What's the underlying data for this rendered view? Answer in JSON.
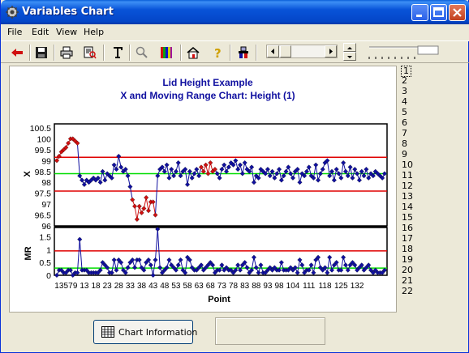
{
  "window": {
    "title": "Variables Chart"
  },
  "menu": [
    "File",
    "Edit",
    "View",
    "Help"
  ],
  "toolbar": {
    "buttons": [
      "back-arrow-icon",
      "save-icon",
      "print-icon",
      "print-preview-icon",
      "text-icon",
      "zoom-icon",
      "color-palette-icon",
      "home-icon",
      "help-icon",
      "chart-options-icon"
    ]
  },
  "list": {
    "items": [
      "1",
      "2",
      "3",
      "4",
      "5",
      "6",
      "7",
      "8",
      "9",
      "10",
      "11",
      "12",
      "13",
      "14",
      "15",
      "16",
      "17",
      "18",
      "19",
      "20",
      "21",
      "22"
    ],
    "selected": "1"
  },
  "buttons": {
    "chart_info": "Chart Information"
  },
  "chart_data": [
    {
      "type": "line",
      "title": "Lid Height Example",
      "subtitle": "X and Moving Range Chart: Height (1)",
      "ylabel": "X",
      "xlabel": "Point",
      "ylim": [
        96,
        100.5
      ],
      "yticks": [
        "100.5",
        "100",
        "99.5",
        "99",
        "98.5",
        "98",
        "97.5",
        "97",
        "96.5",
        "96"
      ],
      "control_limits": {
        "ucl": 99.15,
        "center": 98.4,
        "lcl": 97.6
      },
      "colors": {
        "ucl": "#e00000",
        "center": "#00dd00",
        "lcl": "#e00000",
        "points": "#1010a0",
        "out_of_control": "#d01010",
        "line": "#1010a0"
      },
      "values": [
        99.0,
        99.2,
        99.4,
        99.5,
        99.6,
        99.8,
        100.0,
        100.0,
        99.9,
        99.8,
        98.3,
        98.1,
        97.9,
        98.1,
        98.0,
        98.1,
        98.2,
        98.1,
        98.2,
        98.0,
        98.5,
        98.1,
        98.4,
        98.3,
        98.2,
        98.8,
        98.6,
        99.2,
        98.7,
        98.5,
        98.6,
        98.3,
        97.8,
        97.2,
        96.9,
        96.3,
        96.9,
        96.6,
        96.8,
        97.3,
        96.7,
        97.1,
        97.1,
        96.5,
        98.3,
        98.6,
        98.7,
        98.5,
        98.8,
        98.2,
        98.6,
        98.3,
        98.5,
        98.9,
        98.3,
        98.5,
        98.6,
        97.9,
        98.5,
        98.2,
        98.4,
        98.6,
        98.3,
        98.7,
        98.5,
        98.8,
        98.4,
        98.9,
        98.5,
        98.6,
        98.4,
        98.2,
        98.6,
        98.8,
        98.5,
        98.7,
        98.9,
        98.8,
        99.0,
        98.6,
        98.8,
        98.4,
        98.9,
        98.6,
        98.5,
        98.7,
        98.0,
        98.3,
        98.2,
        98.6,
        98.5,
        98.4,
        98.6,
        98.3,
        98.5,
        98.2,
        98.4,
        98.6,
        98.1,
        98.3,
        98.5,
        98.7,
        98.4,
        98.2,
        98.5,
        98.6,
        98.0,
        98.4,
        98.3,
        98.5,
        98.7,
        98.3,
        98.2,
        98.8,
        98.1,
        98.4,
        98.6,
        98.9,
        99.0,
        98.3,
        98.5,
        98.1,
        98.6,
        98.4,
        98.2,
        98.9,
        98.5,
        98.3,
        98.7,
        98.2,
        98.6,
        98.4,
        98.1,
        98.5,
        98.3,
        98.6,
        98.2,
        98.4,
        98.3,
        98.5,
        98.4,
        98.3,
        98.2,
        98.4
      ],
      "out_of_control_indices": [
        0,
        1,
        2,
        3,
        4,
        5,
        6,
        7,
        8,
        9,
        33,
        34,
        35,
        36,
        37,
        38,
        39,
        40,
        41,
        42,
        43,
        63,
        64,
        65,
        66,
        67,
        68,
        69
      ]
    },
    {
      "type": "line",
      "ylabel": "MR",
      "xlabel": "Point",
      "ylim": [
        0,
        1.8
      ],
      "yticks": [
        "1.5",
        "1",
        "0.5",
        "0"
      ],
      "control_limits": {
        "ucl": 0.95,
        "center": 0.28,
        "lcl": 0
      },
      "x_tick_labels": [
        "1",
        "3",
        "5",
        "7",
        "9",
        "13",
        "18",
        "23",
        "28",
        "33",
        "38",
        "43",
        "48",
        "53",
        "58",
        "63",
        "68",
        "73",
        "78",
        "83",
        "88",
        "93",
        "98",
        "104",
        "111",
        "118",
        "125",
        "132"
      ],
      "values": [
        0.0,
        0.2,
        0.2,
        0.1,
        0.1,
        0.2,
        0.2,
        0.0,
        0.1,
        0.1,
        1.4,
        0.2,
        0.2,
        0.2,
        0.1,
        0.1,
        0.1,
        0.1,
        0.1,
        0.2,
        0.5,
        0.4,
        0.3,
        0.1,
        0.1,
        0.6,
        0.2,
        0.6,
        0.5,
        0.2,
        0.1,
        0.3,
        0.5,
        0.6,
        0.3,
        0.6,
        0.6,
        0.3,
        0.2,
        0.5,
        0.6,
        0.4,
        0.0,
        0.6,
        1.8,
        0.3,
        0.1,
        0.2,
        0.3,
        0.6,
        0.4,
        0.3,
        0.2,
        0.4,
        0.6,
        0.2,
        0.1,
        0.7,
        0.6,
        0.3,
        0.2,
        0.2,
        0.3,
        0.4,
        0.2,
        0.3,
        0.4,
        0.5,
        0.4,
        0.1,
        0.2,
        0.2,
        0.4,
        0.2,
        0.3,
        0.2,
        0.2,
        0.1,
        0.2,
        0.4,
        0.2,
        0.4,
        0.5,
        0.3,
        0.1,
        0.2,
        0.7,
        0.3,
        0.1,
        0.4,
        0.1,
        0.1,
        0.2,
        0.3,
        0.2,
        0.3,
        0.2,
        0.2,
        0.5,
        0.2,
        0.2,
        0.2,
        0.3,
        0.2,
        0.3,
        0.1,
        0.6,
        0.4,
        0.1,
        0.2,
        0.2,
        0.4,
        0.1,
        0.6,
        0.7,
        0.3,
        0.2,
        0.3,
        0.1,
        0.7,
        0.2,
        0.4,
        0.5,
        0.2,
        0.2,
        0.7,
        0.4,
        0.2,
        0.4,
        0.5,
        0.4,
        0.2,
        0.3,
        0.4,
        0.2,
        0.3,
        0.4,
        0.2,
        0.1,
        0.2,
        0.1,
        0.1,
        0.1,
        0.2
      ]
    }
  ]
}
